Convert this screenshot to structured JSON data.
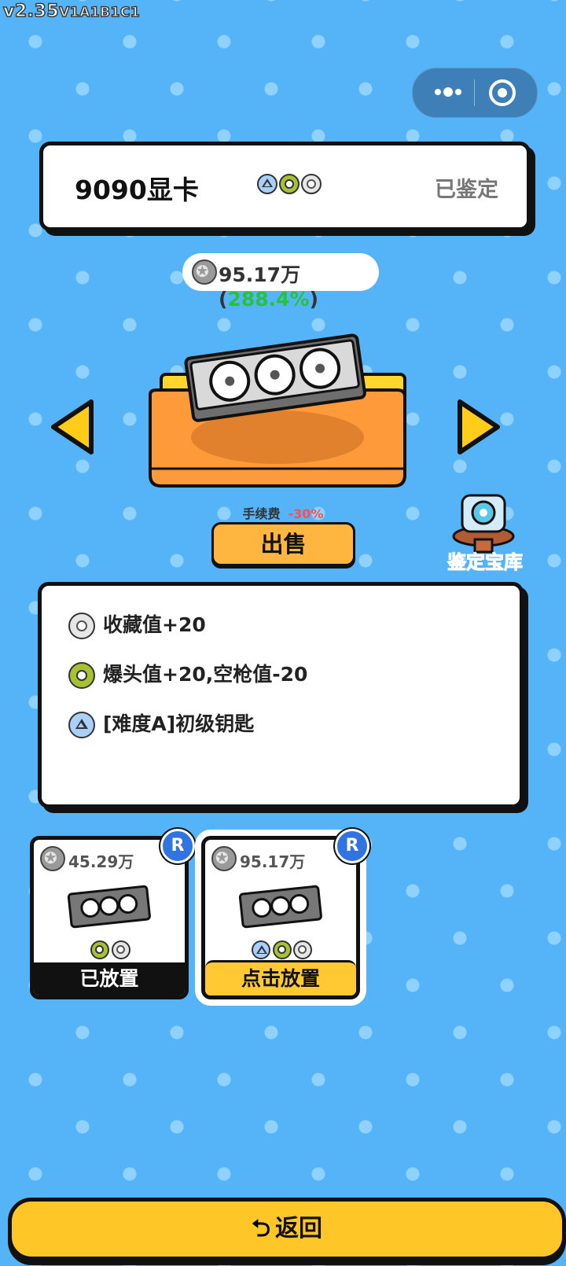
{
  "version": {
    "main": "v2.35",
    "build": "V1A1B1C1"
  },
  "item": {
    "name": "9090显卡",
    "status": "已鉴定",
    "badges": [
      "triangle",
      "ring-green",
      "ring-gray"
    ],
    "price": "95.17万",
    "price_change": "288.4%"
  },
  "sell": {
    "fee_label": "手续费",
    "fee_value": "-30%",
    "button_label": "出售"
  },
  "vault": {
    "label": "鉴定宝库"
  },
  "effects": [
    {
      "icon": "gray-ring-icon",
      "text": "收藏值+20"
    },
    {
      "icon": "green-ring-icon",
      "text": "爆头值+20,空枪值-20"
    },
    {
      "icon": "triangle-icon",
      "text": "[难度A]初级钥匙"
    }
  ],
  "slots": [
    {
      "price": "45.29万",
      "rank": "R",
      "action": "已放置",
      "badges": [
        "ring-green",
        "ring-gray"
      ]
    },
    {
      "price": "95.17万",
      "rank": "R",
      "action": "点击放置",
      "badges": [
        "triangle",
        "ring-green",
        "ring-gray"
      ]
    }
  ],
  "back_button": {
    "label": "返回",
    "icon": "return-arrow-icon"
  },
  "colors": {
    "background": "#55b4f7",
    "accent": "#ffc628",
    "rank": "#2f74e0",
    "positive": "#28c23a",
    "negative": "#ff4d4d"
  }
}
